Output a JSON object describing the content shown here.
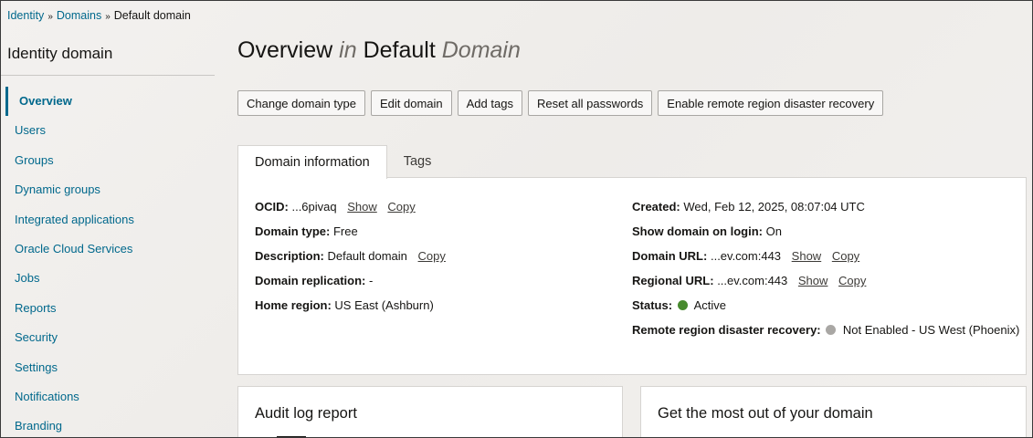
{
  "breadcrumb": {
    "items": [
      "Identity",
      "Domains",
      "Default domain"
    ],
    "sep": "»"
  },
  "sidebar": {
    "title": "Identity domain",
    "items": [
      {
        "label": "Overview"
      },
      {
        "label": "Users"
      },
      {
        "label": "Groups"
      },
      {
        "label": "Dynamic groups"
      },
      {
        "label": "Integrated applications"
      },
      {
        "label": "Oracle Cloud Services"
      },
      {
        "label": "Jobs"
      },
      {
        "label": "Reports"
      },
      {
        "label": "Security"
      },
      {
        "label": "Settings"
      },
      {
        "label": "Notifications"
      },
      {
        "label": "Branding"
      }
    ]
  },
  "header": {
    "title_a": "Overview",
    "title_in": "in",
    "title_b": "Default",
    "title_c": "Domain"
  },
  "actions": {
    "change_type": "Change domain type",
    "edit": "Edit domain",
    "add_tags": "Add tags",
    "reset_passwords": "Reset all passwords",
    "remote_recovery": "Enable remote region disaster recovery"
  },
  "tabs": {
    "domain_info": "Domain information",
    "tags": "Tags"
  },
  "info": {
    "ocid_label": "OCID:",
    "ocid_value": "...6pivaq",
    "show": "Show",
    "copy": "Copy",
    "type_label": "Domain type:",
    "type_value": "Free",
    "desc_label": "Description:",
    "desc_value": "Default domain",
    "replication_label": "Domain replication:",
    "replication_value": "-",
    "home_label": "Home region:",
    "home_value": "US East (Ashburn)",
    "created_label": "Created:",
    "created_value": "Wed, Feb 12, 2025, 08:07:04 UTC",
    "login_label": "Show domain on login:",
    "login_value": "On",
    "url_label": "Domain URL:",
    "url_value": "...ev.com:443",
    "regional_label": "Regional URL:",
    "regional_value": "...ev.com:443",
    "status_label": "Status:",
    "status_value": "Active",
    "remote_label": "Remote region disaster recovery:",
    "remote_value": "Not Enabled - US West (Phoenix)"
  },
  "colors": {
    "status_active": "#478a2e",
    "status_disabled": "#a9a7a4",
    "link": "#00688c"
  },
  "cards": {
    "audit": "Audit log report",
    "getmost": "Get the most out of your domain"
  }
}
